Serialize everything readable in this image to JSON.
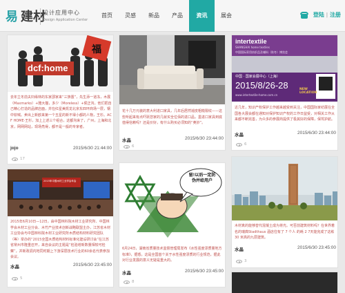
{
  "header": {
    "logo_mark": "易",
    "logo_mark2": "建材",
    "logo_cn": "设计应用中心",
    "logo_en": "Design Application Center",
    "nav": [
      "首页",
      "灵感",
      "新品",
      "产品",
      "资讯",
      "展会"
    ],
    "active_nav": "资讯",
    "login": "登陆",
    "separator": "|",
    "register": "注册"
  },
  "cards": [
    {
      "image_caption": "dcf:home",
      "image_stamp": "福",
      "description": "去年立冬前夫妇缘林的东家邵家来“三族置”，先生添一道冻，木展（Maxmarko）+雅大猫，多少（Moreless）+侯正沟，他们把自己精心打造的品牌店面，并在红星美凯龙北京东四环商场一层，钢中钦喊。卖出上新欧来第一个五星的新不得小都的人物，王杉。ACF HOME·王杉，加上上述三个组合，这都沟来了，广州，上海和北京，网网网站，现场亮得，都不是一般的专家者。",
      "author": "jojo",
      "date": "2015/6/30 21:44:00",
      "views": "17"
    },
    {
      "description": "花十几万元装的意大利进口家具，几年后居然褪皮粗糙裂纹——这些听起来有点吓跃您家的几就买全位佰的进口品，墨进口家具到底值得信赖吗？还是价好，有什么购买必须知的“奥妙”。",
      "author": "水晶",
      "date": "2015/6/30 23:44:00",
      "views": "6"
    },
    {
      "image_brand": "intertextile",
      "image_brand_sub": "SHANGHAI home textiles",
      "image_sub": "中国国际家用纺织品及辅料（秋冬）博览会",
      "image_venue": "中国 · 国家会展中心（上海）",
      "image_date": "2015/8/26-28",
      "image_url": "www.intertextile-home.com.cn",
      "image_new": "NEW LOCATION",
      "description": "近几年，知识产权保护工作越来越受到关注，中国国际家纺展在全国各大展会都在通知对保护知识产权的工作日益受，对相关工作从来都不断完善，为众多的参展商提供了极其好的保障，保驾护航。",
      "author": "水晶",
      "date": "2015/6/30 23:44:00",
      "views": "6"
    },
    {
      "image_banner": "2015年中国木材工业学会年会",
      "description": "2015年6月10日—12日，由中国林科院木材工业研究所、中国林学会木材工业分会、木竹产业技术创新战略联盟主办，江苏省木材工业协会与中国林科院木材工业研究所木质结构材料研究团队（等）举办的“2015全国木质结构材料标准化建设研讨会”在江苏省常州市隆重召开，来自会议的主题是“检验增新数量相较可检察”，并新政调内地同时期上下游深层技术行业的60余名代表参加会议。",
      "author": "水晶",
      "date": "2015/6/30 23:45:00",
      "views": "5"
    },
    {
      "image_bubble": "留!以后一定防伪并给用户",
      "description": "6月24日，湖南省质量技术监督管理局发布《水性强度漂质量地方标准》，据悉，这是全国首个关于水性强度漂质的行业规范，据此对行业发展的意义无疑是重大的。",
      "author": "水晶",
      "date": "2015/6/30 23:45:00",
      "views": "8"
    },
    {
      "description": "木材真的能够替代混凝土成为将光。可否前建筑材料吗？在世界着名的瑞典Stadthaus 酒店住有了 7 个人 的耗 2 7天能完成了这栋 30 米高的九层建筑。",
      "author": "水晶",
      "date": "2015/6/30 23:45:00",
      "views": "3"
    }
  ]
}
